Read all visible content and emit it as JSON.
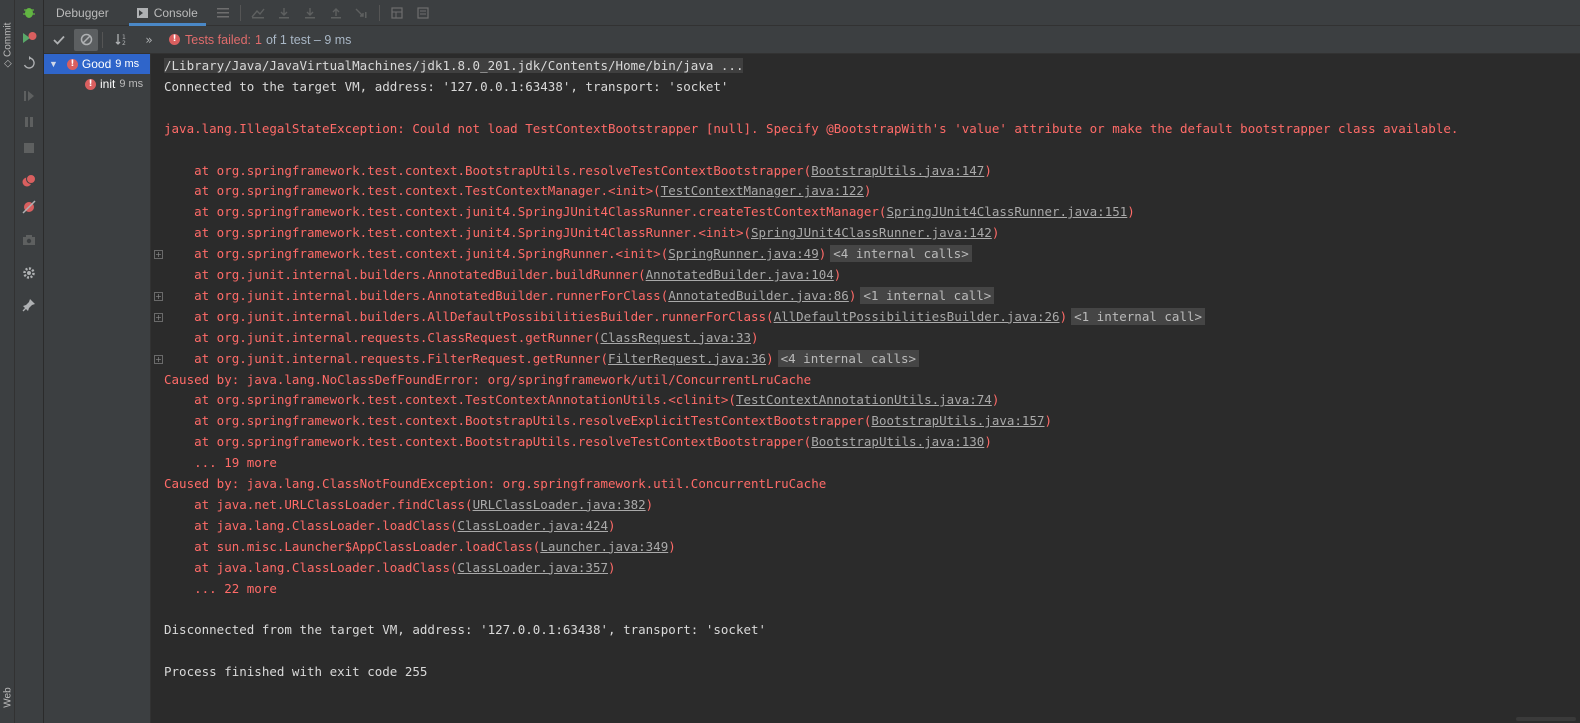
{
  "side_labels": {
    "commit": "Commit",
    "web": "Web"
  },
  "tabs": [
    {
      "label": "Debugger",
      "active": false
    },
    {
      "label": "Console",
      "active": true
    }
  ],
  "toolbar": {
    "status_prefix": "Tests failed:",
    "failed_count": "1",
    "summary": "of 1 test – 9 ms"
  },
  "tree": {
    "root": {
      "name": "Good",
      "time": "9 ms"
    },
    "child": {
      "name": "init",
      "time": "9 ms"
    }
  },
  "console": {
    "lines": [
      {
        "segments": [
          {
            "t": "/Library/Java/JavaVirtualMachines/jdk1.8.0_201.jdk/Contents/Home/bin/java ...",
            "c": "plain hl"
          }
        ]
      },
      {
        "segments": [
          {
            "t": "Connected to the target VM, address: '127.0.0.1:63438', transport: 'socket'",
            "c": "plain"
          }
        ]
      },
      {
        "segments": []
      },
      {
        "segments": [
          {
            "t": "java.lang.IllegalStateException: Could not load TestContextBootstrapper [null]. Specify @BootstrapWith's 'value' attribute or make the default bootstrapper class available.",
            "c": "red"
          }
        ]
      },
      {
        "segments": []
      },
      {
        "segments": [
          {
            "t": "    at org.springframework.test.context.BootstrapUtils.resolveTestContextBootstrapper(",
            "c": "red"
          },
          {
            "t": "BootstrapUtils.java:147",
            "c": "link"
          },
          {
            "t": ")",
            "c": "red"
          }
        ]
      },
      {
        "segments": [
          {
            "t": "    at org.springframework.test.context.TestContextManager.<init>(",
            "c": "red"
          },
          {
            "t": "TestContextManager.java:122",
            "c": "link"
          },
          {
            "t": ")",
            "c": "red"
          }
        ]
      },
      {
        "segments": [
          {
            "t": "    at org.springframework.test.context.junit4.SpringJUnit4ClassRunner.createTestContextManager(",
            "c": "red"
          },
          {
            "t": "SpringJUnit4ClassRunner.java:151",
            "c": "link"
          },
          {
            "t": ")",
            "c": "red"
          }
        ]
      },
      {
        "segments": [
          {
            "t": "    at org.springframework.test.context.junit4.SpringJUnit4ClassRunner.<init>(",
            "c": "red"
          },
          {
            "t": "SpringJUnit4ClassRunner.java:142",
            "c": "link"
          },
          {
            "t": ")",
            "c": "red"
          }
        ]
      },
      {
        "fold": true,
        "segments": [
          {
            "t": "    at org.springframework.test.context.junit4.SpringRunner.<init>(",
            "c": "red"
          },
          {
            "t": "SpringRunner.java:49",
            "c": "link"
          },
          {
            "t": ")",
            "c": "red"
          },
          {
            "t": "<4 internal calls>",
            "c": "pill"
          }
        ]
      },
      {
        "segments": [
          {
            "t": "    at org.junit.internal.builders.AnnotatedBuilder.buildRunner(",
            "c": "red"
          },
          {
            "t": "AnnotatedBuilder.java:104",
            "c": "link"
          },
          {
            "t": ")",
            "c": "red"
          }
        ]
      },
      {
        "fold": true,
        "segments": [
          {
            "t": "    at org.junit.internal.builders.AnnotatedBuilder.runnerForClass(",
            "c": "red"
          },
          {
            "t": "AnnotatedBuilder.java:86",
            "c": "link"
          },
          {
            "t": ")",
            "c": "red"
          },
          {
            "t": "<1 internal call>",
            "c": "pill"
          }
        ]
      },
      {
        "fold": true,
        "segments": [
          {
            "t": "    at org.junit.internal.builders.AllDefaultPossibilitiesBuilder.runnerForClass(",
            "c": "red"
          },
          {
            "t": "AllDefaultPossibilitiesBuilder.java:26",
            "c": "link"
          },
          {
            "t": ")",
            "c": "red"
          },
          {
            "t": "<1 internal call>",
            "c": "pill"
          }
        ]
      },
      {
        "segments": [
          {
            "t": "    at org.junit.internal.requests.ClassRequest.getRunner(",
            "c": "red"
          },
          {
            "t": "ClassRequest.java:33",
            "c": "link"
          },
          {
            "t": ")",
            "c": "red"
          }
        ]
      },
      {
        "fold": true,
        "segments": [
          {
            "t": "    at org.junit.internal.requests.FilterRequest.getRunner(",
            "c": "red"
          },
          {
            "t": "FilterRequest.java:36",
            "c": "link"
          },
          {
            "t": ")",
            "c": "red"
          },
          {
            "t": "<4 internal calls>",
            "c": "pill"
          }
        ]
      },
      {
        "segments": [
          {
            "t": "Caused by: java.lang.NoClassDefFoundError: org/springframework/util/ConcurrentLruCache",
            "c": "red"
          }
        ]
      },
      {
        "segments": [
          {
            "t": "    at org.springframework.test.context.TestContextAnnotationUtils.<clinit>(",
            "c": "red"
          },
          {
            "t": "TestContextAnnotationUtils.java:74",
            "c": "link"
          },
          {
            "t": ")",
            "c": "red"
          }
        ]
      },
      {
        "segments": [
          {
            "t": "    at org.springframework.test.context.BootstrapUtils.resolveExplicitTestContextBootstrapper(",
            "c": "red"
          },
          {
            "t": "BootstrapUtils.java:157",
            "c": "link"
          },
          {
            "t": ")",
            "c": "red"
          }
        ]
      },
      {
        "segments": [
          {
            "t": "    at org.springframework.test.context.BootstrapUtils.resolveTestContextBootstrapper(",
            "c": "red"
          },
          {
            "t": "BootstrapUtils.java:130",
            "c": "link"
          },
          {
            "t": ")",
            "c": "red"
          }
        ]
      },
      {
        "segments": [
          {
            "t": "    ... 19 more",
            "c": "red"
          }
        ]
      },
      {
        "segments": [
          {
            "t": "Caused by: java.lang.ClassNotFoundException: org.springframework.util.ConcurrentLruCache",
            "c": "red"
          }
        ]
      },
      {
        "segments": [
          {
            "t": "    at java.net.URLClassLoader.findClass(",
            "c": "red"
          },
          {
            "t": "URLClassLoader.java:382",
            "c": "link"
          },
          {
            "t": ")",
            "c": "red"
          }
        ]
      },
      {
        "segments": [
          {
            "t": "    at java.lang.ClassLoader.loadClass(",
            "c": "red"
          },
          {
            "t": "ClassLoader.java:424",
            "c": "link"
          },
          {
            "t": ")",
            "c": "red"
          }
        ]
      },
      {
        "segments": [
          {
            "t": "    at sun.misc.Launcher$AppClassLoader.loadClass(",
            "c": "red"
          },
          {
            "t": "Launcher.java:349",
            "c": "link"
          },
          {
            "t": ")",
            "c": "red"
          }
        ]
      },
      {
        "segments": [
          {
            "t": "    at java.lang.ClassLoader.loadClass(",
            "c": "red"
          },
          {
            "t": "ClassLoader.java:357",
            "c": "link"
          },
          {
            "t": ")",
            "c": "red"
          }
        ]
      },
      {
        "segments": [
          {
            "t": "    ... 22 more",
            "c": "red"
          }
        ]
      },
      {
        "segments": []
      },
      {
        "segments": [
          {
            "t": "Disconnected from the target VM, address: '127.0.0.1:63438', transport: 'socket'",
            "c": "plain"
          }
        ]
      },
      {
        "segments": []
      },
      {
        "segments": [
          {
            "t": "Process finished with exit code 255",
            "c": "plain"
          }
        ]
      }
    ]
  },
  "colors": {
    "error": "#ff6b68",
    "selection": "#2f65ca",
    "accent": "#4a88c7"
  }
}
